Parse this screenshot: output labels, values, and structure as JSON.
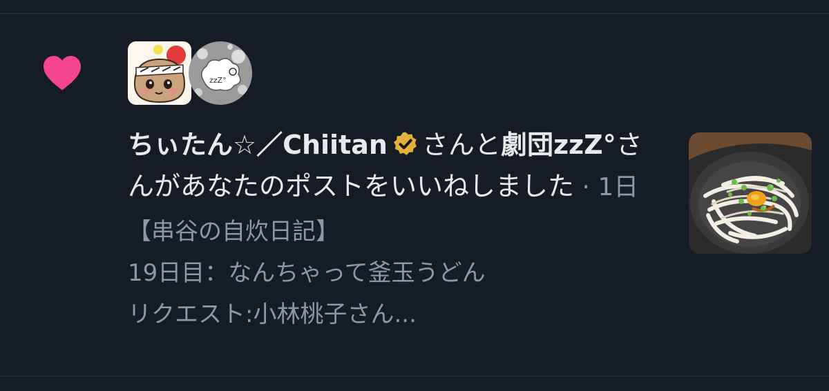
{
  "colors": {
    "background": "#151c26",
    "heart": "#f4458e",
    "verified": "#e1b13b",
    "primary_text": "#e7e9ea",
    "secondary_text": "#8b98a5"
  },
  "icons": {
    "heart": "heart-icon",
    "verified": "verified-badge-icon"
  },
  "notification": {
    "user1_name": "ちぃたん☆／Chiitan",
    "connector": "さんと",
    "user2_name": "劇団zzZ°",
    "action": "さんがあなたのポストをいいねしました",
    "separator": " · ",
    "time": "1日"
  },
  "post_preview": {
    "line1": "【串谷の自炊日記】",
    "line2": "19日目：なんちゃって釜玉うどん",
    "line3": "リクエスト:小林桃子さん..."
  }
}
